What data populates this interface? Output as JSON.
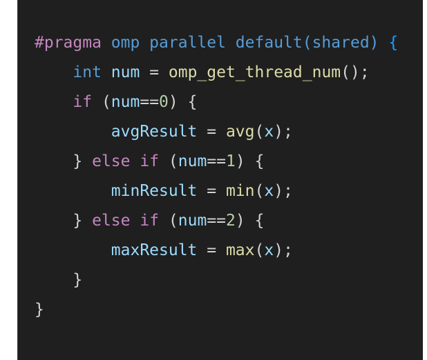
{
  "editor": {
    "lines": [
      [
        {
          "t": "#pragma",
          "c": "directive"
        },
        {
          "t": " ",
          "c": "plain"
        },
        {
          "t": "omp parallel default(shared)",
          "c": "keyword"
        },
        {
          "t": " ",
          "c": "plain"
        },
        {
          "t": "{",
          "c": "brace-blue"
        }
      ],
      [
        {
          "t": "    ",
          "c": "plain"
        },
        {
          "t": "int",
          "c": "keyword"
        },
        {
          "t": " ",
          "c": "plain"
        },
        {
          "t": "num",
          "c": "ident"
        },
        {
          "t": " = ",
          "c": "plain"
        },
        {
          "t": "omp_get_thread_num",
          "c": "func"
        },
        {
          "t": "();",
          "c": "plain"
        }
      ],
      [
        {
          "t": "    ",
          "c": "plain"
        },
        {
          "t": "if",
          "c": "control"
        },
        {
          "t": " (",
          "c": "plain"
        },
        {
          "t": "num",
          "c": "ident"
        },
        {
          "t": "==",
          "c": "plain"
        },
        {
          "t": "0",
          "c": "number"
        },
        {
          "t": ") ",
          "c": "plain"
        },
        {
          "t": "{",
          "c": "plain"
        }
      ],
      [
        {
          "t": "        ",
          "c": "plain"
        },
        {
          "t": "avgResult",
          "c": "ident"
        },
        {
          "t": " = ",
          "c": "plain"
        },
        {
          "t": "avg",
          "c": "func"
        },
        {
          "t": "(",
          "c": "plain"
        },
        {
          "t": "x",
          "c": "ident"
        },
        {
          "t": ");",
          "c": "plain"
        }
      ],
      [
        {
          "t": "    ",
          "c": "plain"
        },
        {
          "t": "}",
          "c": "plain"
        },
        {
          "t": " ",
          "c": "plain"
        },
        {
          "t": "else",
          "c": "control"
        },
        {
          "t": " ",
          "c": "plain"
        },
        {
          "t": "if",
          "c": "control"
        },
        {
          "t": " (",
          "c": "plain"
        },
        {
          "t": "num",
          "c": "ident"
        },
        {
          "t": "==",
          "c": "plain"
        },
        {
          "t": "1",
          "c": "number"
        },
        {
          "t": ") ",
          "c": "plain"
        },
        {
          "t": "{",
          "c": "plain"
        }
      ],
      [
        {
          "t": "        ",
          "c": "plain"
        },
        {
          "t": "minResult",
          "c": "ident"
        },
        {
          "t": " = ",
          "c": "plain"
        },
        {
          "t": "min",
          "c": "func"
        },
        {
          "t": "(",
          "c": "plain"
        },
        {
          "t": "x",
          "c": "ident"
        },
        {
          "t": ");",
          "c": "plain"
        }
      ],
      [
        {
          "t": "    ",
          "c": "plain"
        },
        {
          "t": "}",
          "c": "plain"
        },
        {
          "t": " ",
          "c": "plain"
        },
        {
          "t": "else",
          "c": "control"
        },
        {
          "t": " ",
          "c": "plain"
        },
        {
          "t": "if",
          "c": "control"
        },
        {
          "t": " (",
          "c": "plain"
        },
        {
          "t": "num",
          "c": "ident"
        },
        {
          "t": "==",
          "c": "plain"
        },
        {
          "t": "2",
          "c": "number"
        },
        {
          "t": ") ",
          "c": "plain"
        },
        {
          "t": "{",
          "c": "plain"
        }
      ],
      [
        {
          "t": "        ",
          "c": "plain"
        },
        {
          "t": "maxResult",
          "c": "ident"
        },
        {
          "t": " = ",
          "c": "plain"
        },
        {
          "t": "max",
          "c": "func"
        },
        {
          "t": "(",
          "c": "plain"
        },
        {
          "t": "x",
          "c": "ident"
        },
        {
          "t": ");",
          "c": "plain"
        }
      ],
      [
        {
          "t": "    ",
          "c": "plain"
        },
        {
          "t": "}",
          "c": "plain"
        }
      ],
      [
        {
          "t": "}",
          "c": "plain"
        }
      ]
    ]
  },
  "colors": {
    "background": "#1f1f1f",
    "directive": "#c586c0",
    "keyword": "#569cd6",
    "control": "#c586c0",
    "identifier": "#9cdcfe",
    "function": "#dcdcaa",
    "number": "#b5cea8",
    "plain": "#d4d4d4"
  }
}
